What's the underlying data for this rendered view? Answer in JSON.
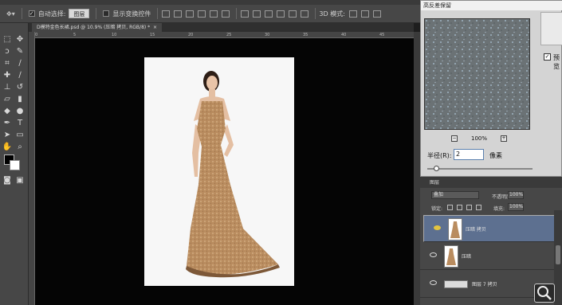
{
  "options_bar": {
    "auto_select_label": "自动选择:",
    "auto_select_checked": true,
    "auto_select_target": "图层",
    "show_transform_label": "显示变换控件",
    "mode_3d_label": "3D 模式:"
  },
  "document": {
    "tab_title": "D模特金色长裙.psd @ 10.9% (压暗 拷贝, RGB/8) *",
    "ruler_ticks": [
      "0",
      "5",
      "10",
      "15",
      "20",
      "25",
      "30",
      "35",
      "40",
      "45"
    ]
  },
  "dialog": {
    "title": "高反差保留",
    "zoom_value": "100%",
    "radius_label": "半径(R):",
    "radius_value": "2",
    "radius_unit": "像素",
    "preview_label": "预览",
    "preview_checked": true,
    "radius_slider_level": 0.06
  },
  "layers_panel": {
    "tab_label": "图层",
    "blend_mode": "叠加",
    "opacity_label": "不透明度:",
    "opacity_value": "100%",
    "lock_label": "锁定:",
    "fill_label": "填充:",
    "fill_value": "100%",
    "layers": [
      {
        "name": "压暗 拷贝",
        "selected": true
      },
      {
        "name": "压暗",
        "selected": false
      },
      {
        "name": "图层 7 拷贝",
        "selected": false
      }
    ]
  },
  "colors": {
    "canvas_bg": "#050505",
    "ui_panel": "#474747",
    "selected_layer": "#5d7090",
    "dress_gold": "#b98c5f"
  }
}
